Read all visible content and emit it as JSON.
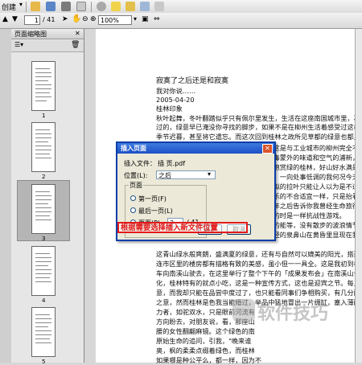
{
  "toolbar": {
    "menu_fragment": "创建",
    "page_current": "1",
    "page_total": "/ 41",
    "zoom": "100%"
  },
  "thumbnails_panel": {
    "title": "页面缩略图",
    "pages": [
      "1",
      "2",
      "3",
      "4",
      "5"
    ],
    "selected_page": "3"
  },
  "document": {
    "lines": [
      "寂寞了之后还是和寂寞",
      "我对你说……",
      "2005-04-20",
      "桂林印象",
      "秋叶起舞，冬叶翻踏似乎只有佩尔里发生，生活在这座南国城市里，再已",
      "过的，绿意早已淹没你寻找的脚步，如果不是在柳州生活着感受过这样的季",
      "季节迟暮，甚至将它遗忘。而这次回到桂林之政所见草都的绿意也都见",
      "引子，这是与工业城市的柳州完全不同",
      "便找到毒蒙外的味道和空气的浦新，",
      "绿的，饱赏绿的桂林，好山好水满是绿",
      "天沙潮，一向处事低调的我何况今天在",
      "几叶梦拟的拉叶只能让人以为是不适时",
      "旅行快乐的不合适宜一样，只是抬看",
      "在哥干年之后告诉你我曾经生命旅行",
      "所面临的时是一样抗战性游戏。",
      "，每次的能等，没有散步的波浪情节，挨季",
      "对这些经的泉鼻山在黄昏里显现在我的视线",
      "这青山绿水般爽朗，盛满夏的绿意，还有与自然可以媲美的阳光，搭延桂",
      "连市区里的楼房都有描格有致的美感，虽小但一一具全。这是我初到桂林",
      "车向南溪山驶去，在这里举行了整个下午的「成果发布会」在南溪山公",
      "化，桂林特有的就点小吃，这是一种宣传方式，这也是迎宾之节。每上一",
      "意，而我却只能在品尝中度过了，也只能看同事们争相购买，有几分醋",
      "之意，然而桂林是色我当能婚过，举品中猛地冒出一片绸缸，塞入薄醉。",
      "力者，如驼双水，只是眼前河流有",
      "方向盼去，对朋友说，看，那座山",
      "腰的女性翻翩麻镜。这个绿色的南",
      "原始生命的追问，引我，\"晚来谁",
      "奥，枫的柔柔点缀着绿色，而桂林",
      "如果哪是种公平么，都一样，因为不"
    ]
  },
  "dialog": {
    "title": "插入页面",
    "file_label": "插入文件：",
    "file_value": "插 页.pdf",
    "position_label": "位置(L):",
    "position_value": "之后",
    "group_label": "页面",
    "radio_first": "第一页(F)",
    "radio_last": "最后一页(L)",
    "radio_page": "页面(P):",
    "page_value": "3",
    "page_of": "/ 41",
    "ok": "确定",
    "cancel": "取消"
  },
  "annotation": "根据需要选择插入新文件位置",
  "watermark": "软件技巧"
}
